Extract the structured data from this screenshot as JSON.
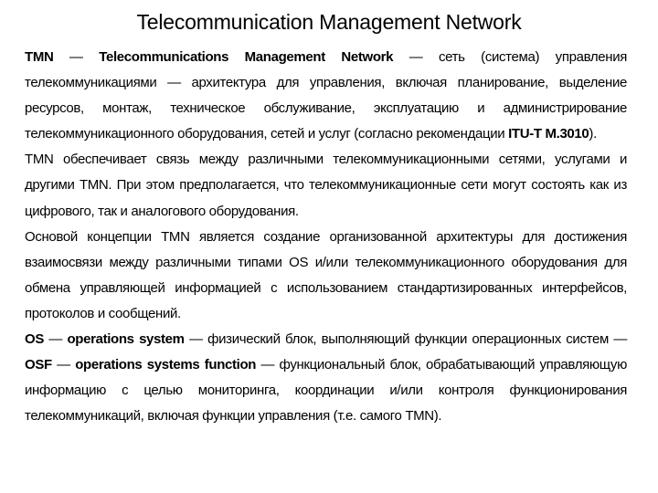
{
  "slide": {
    "title": "Telecommunication Management Network",
    "paragraphs": [
      {
        "p1_term": "TMN",
        "p1_dash1": " — ",
        "p1_term_full": "Telecommunications Management Network",
        "p1_text": " — сеть (система) управления телекоммуникациями — архитектура для управления, включая планирование, выделение ресурсов, монтаж, техническое обслуживание, эксплуатацию и администрирование телекоммуникационного оборудования, сетей и услуг (согласно рекомендации ",
        "p1_ref": "ITU-T M.3010",
        "p1_end": ")."
      },
      {
        "text": "TMN обеспечивает связь между различными телекоммуникационными сетями, услугами и другими TMN. При этом предполагается, что телекоммуникационные сети могут состоять как из цифрового, так и аналогового оборудования."
      },
      {
        "text": "Основой концепции TMN является создание организованной архитектуры для достижения взаимосвязи между различными типами OS и/или телекоммуникационного оборудования для обмена управляющей информацией с использованием стандартизированных интерфейсов, протоколов и сообщений."
      },
      {
        "os_term": "OS",
        "dash1": " — ",
        "os_full": "operations system",
        "text1": " — физический блок, выполняющий функции операционных систем — ",
        "osf_term": "OSF",
        "dash2": " — ",
        "osf_full": "operations systems function",
        "text2": " — функциональный блок, обрабатывающий управляющую информацию с целью мониторинга, координации и/или контроля функционирования телекоммуникаций, включая функции управления (т.е. самого TMN)."
      }
    ]
  }
}
